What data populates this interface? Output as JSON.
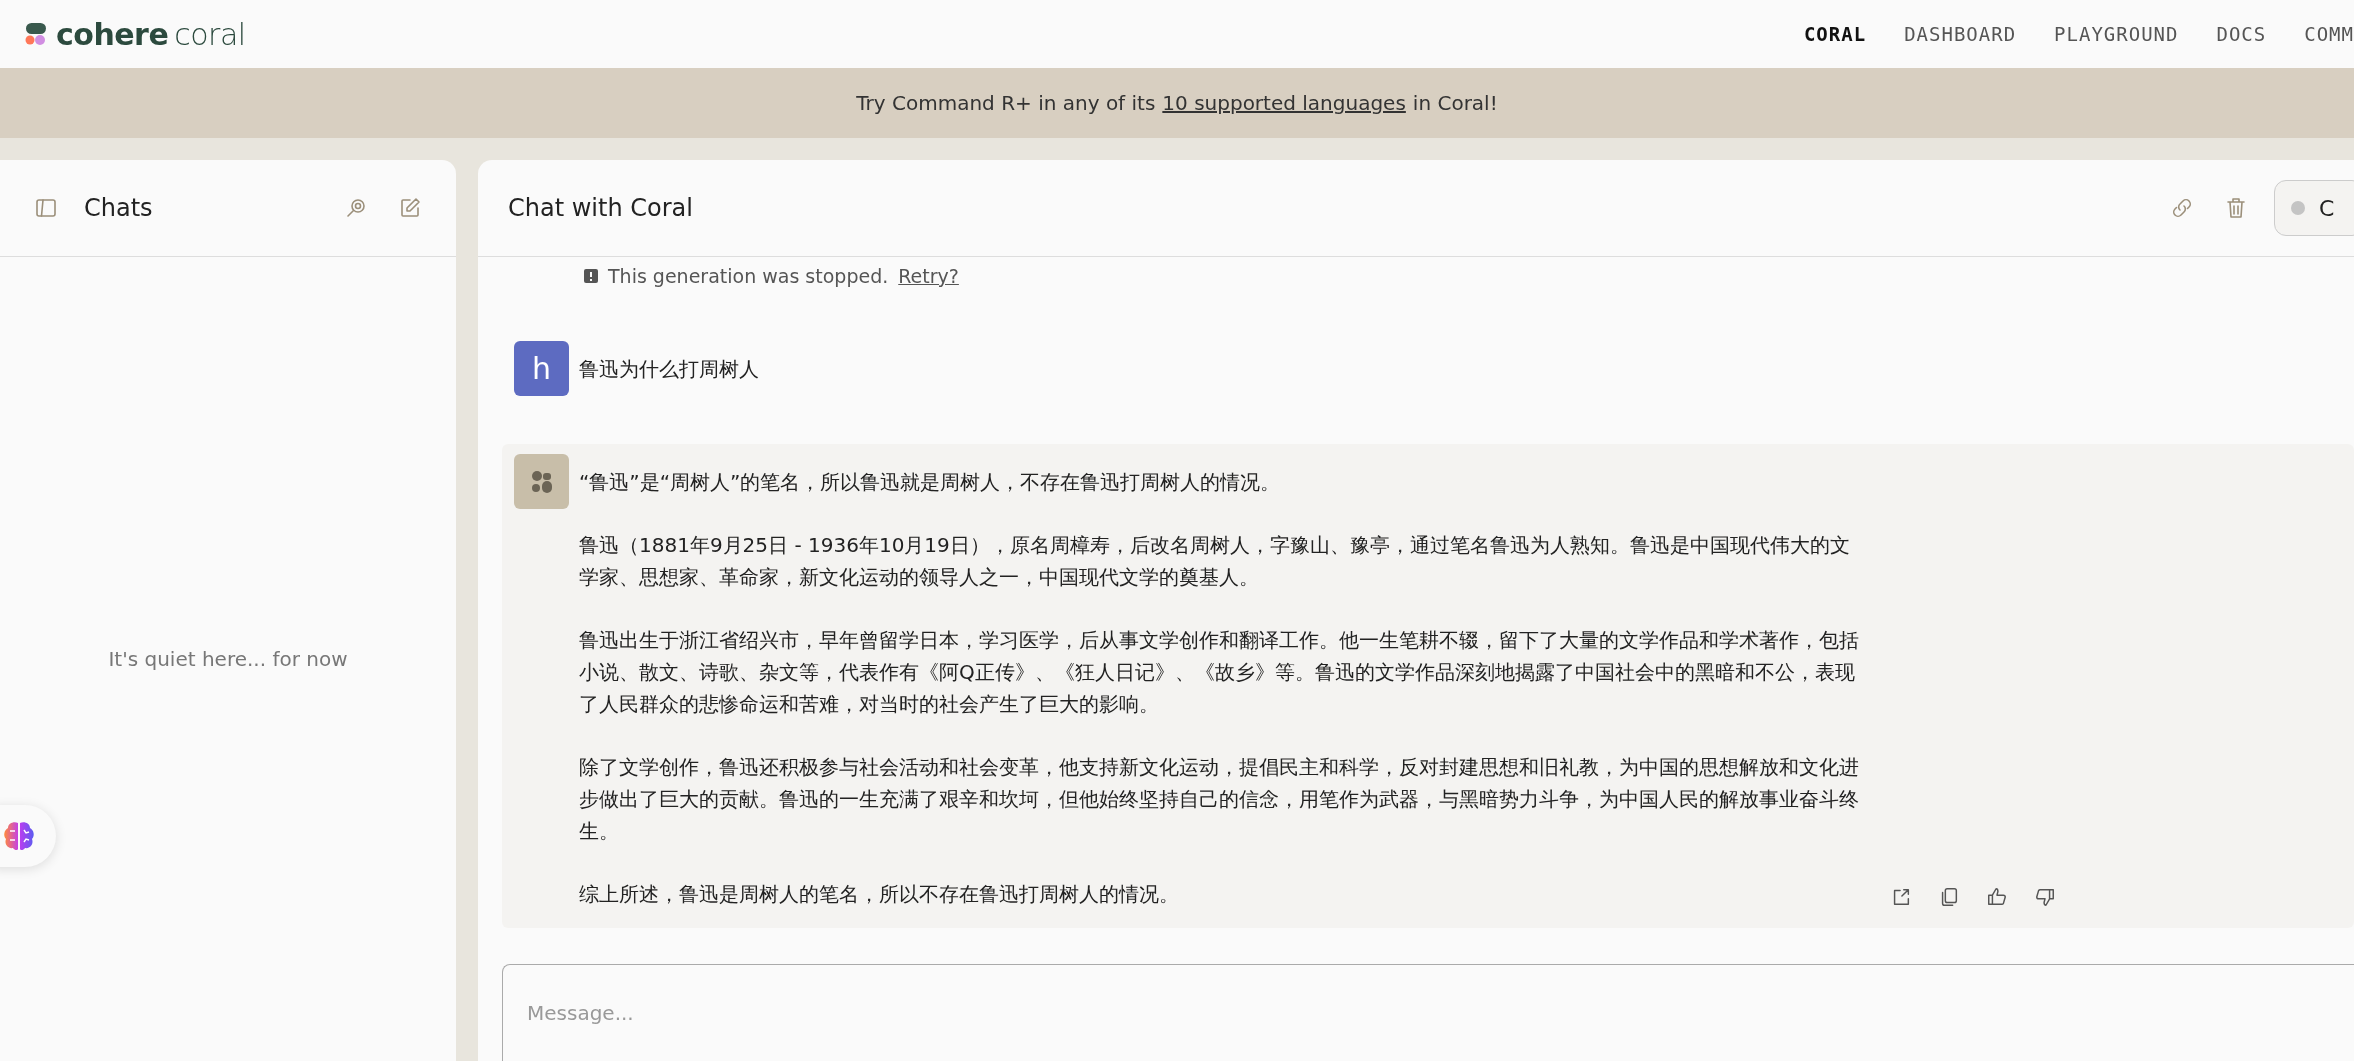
{
  "logo": {
    "brand": "cohere",
    "product": "coral"
  },
  "nav": [
    {
      "label": "CORAL",
      "selected": true
    },
    {
      "label": "DASHBOARD",
      "selected": false
    },
    {
      "label": "PLAYGROUND",
      "selected": false
    },
    {
      "label": "DOCS",
      "selected": false
    },
    {
      "label": "COMM",
      "selected": false
    }
  ],
  "banner": {
    "before": "Try Command R+ in any of its",
    "link": "10 supported languages",
    "after": "in Coral!"
  },
  "sidebar": {
    "title": "Chats",
    "empty_text": "It's quiet here... for now"
  },
  "chat": {
    "title": "Chat with Coral",
    "model_button": "C",
    "stopped_notice": {
      "text": "This generation was stopped.",
      "link": "Retry?"
    },
    "messages": [
      {
        "kind": "user",
        "avatar": "h",
        "paragraphs": [
          "鲁迅为什么打周树人"
        ]
      },
      {
        "kind": "bot",
        "paragraphs": [
          "“鲁迅”是“周树人”的笔名，所以鲁迅就是周树人，不存在鲁迅打周树人的情况。",
          "鲁迅（1881年9月25日 - 1936年10月19日），原名周樟寿，后改名周树人，字豫山、豫亭，通过笔名鲁迅为人熟知。鲁迅是中国现代伟大的文学家、思想家、革命家，新文化运动的领导人之一，中国现代文学的奠基人。",
          "鲁迅出生于浙江省绍兴市，早年曾留学日本，学习医学，后从事文学创作和翻译工作。他一生笔耕不辍，留下了大量的文学作品和学术著作，包括小说、散文、诗歌、杂文等，代表作有《阿Q正传》、《狂人日记》、《故乡》等。鲁迅的文学作品深刻地揭露了中国社会中的黑暗和不公，表现了人民群众的悲惨命运和苦难，对当时的社会产生了巨大的影响。",
          "除了文学创作，鲁迅还积极参与社会活动和社会变革，他支持新文化运动，提倡民主和科学，反对封建思想和旧礼教，为中国的思想解放和文化进步做出了巨大的贡献。鲁迅的一生充满了艰辛和坎坷，但他始终坚持自己的信念，用笔作为武器，与黑暗势力斗争，为中国人民的解放事业奋斗终生。",
          "综上所述，鲁迅是周树人的笔名，所以不存在鲁迅打周树人的情况。"
        ]
      }
    ],
    "composer": {
      "placeholder": "Message..."
    }
  }
}
